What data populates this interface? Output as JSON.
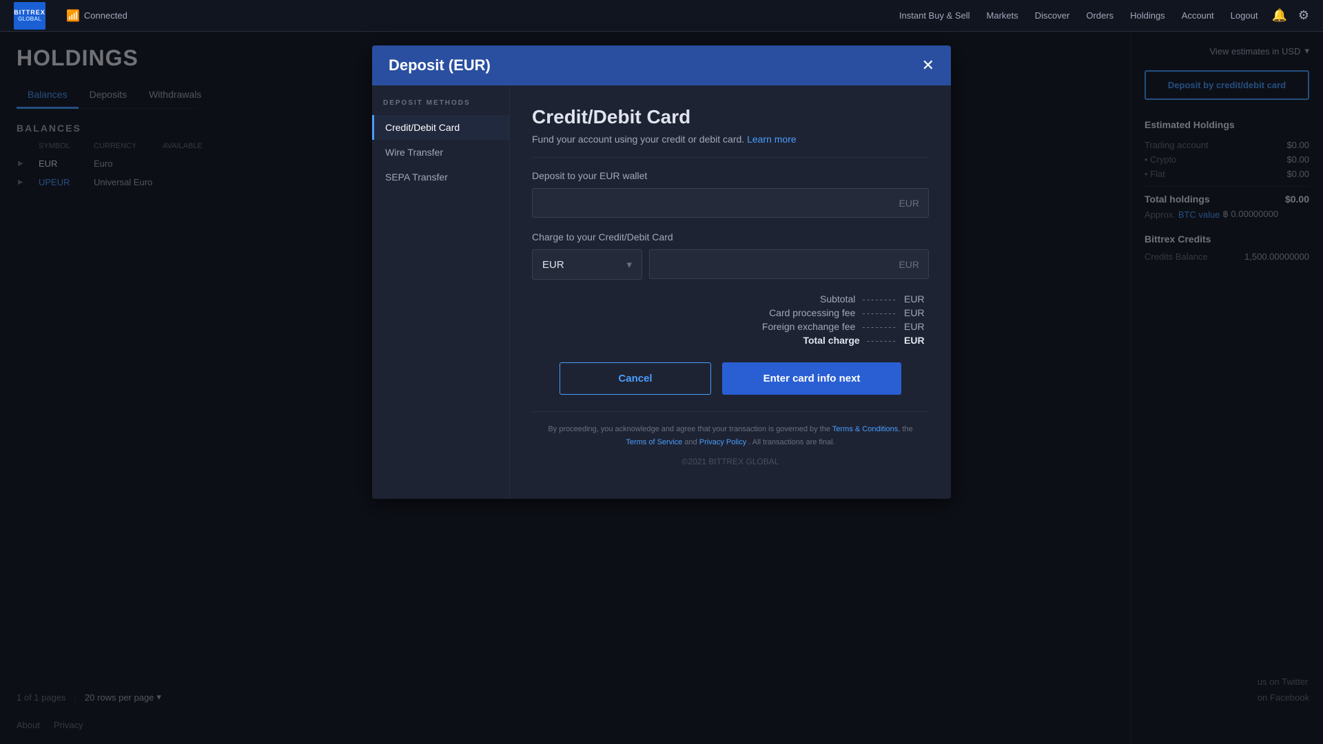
{
  "app": {
    "logo_line1": "BITTREX",
    "logo_line2": "GLOBAL"
  },
  "topnav": {
    "connected_label": "Connected",
    "nav_links": [
      {
        "label": "Instant Buy & Sell",
        "key": "instant-buy-sell"
      },
      {
        "label": "Markets",
        "key": "markets"
      },
      {
        "label": "Discover",
        "key": "discover"
      },
      {
        "label": "Orders",
        "key": "orders"
      },
      {
        "label": "Holdings",
        "key": "holdings"
      },
      {
        "label": "Account",
        "key": "account"
      },
      {
        "label": "Logout",
        "key": "logout"
      }
    ]
  },
  "left": {
    "page_title": "HOLDINGS",
    "tabs": [
      {
        "label": "Balances",
        "active": true
      },
      {
        "label": "Deposits",
        "active": false
      },
      {
        "label": "Withdrawals",
        "active": false
      }
    ],
    "balances_title": "BALANCES",
    "table_headers": [
      "",
      "SYMBOL",
      "CURRENCY",
      "AVAILABLE"
    ],
    "rows": [
      {
        "symbol": "EUR",
        "currency": "Euro",
        "available": ""
      },
      {
        "symbol": "UPEUR",
        "currency": "Universal Euro",
        "available": "",
        "link": true
      }
    ],
    "pagination": {
      "pages_text": "1 of 1 pages",
      "rows_label": "20 rows per page"
    },
    "footer": {
      "about": "About",
      "privacy": "Privacy"
    }
  },
  "modal": {
    "title": "Deposit (EUR)",
    "deposit_methods_label": "DEPOSIT METHODS",
    "methods": [
      {
        "label": "Credit/Debit Card",
        "active": true
      },
      {
        "label": "Wire Transfer",
        "active": false
      },
      {
        "label": "SEPA Transfer",
        "active": false
      }
    ],
    "card_title": "Credit/Debit Card",
    "card_subtitle": "Fund your account using your credit or debit card.",
    "learn_more": "Learn more",
    "deposit_wallet_label": "Deposit to your EUR wallet",
    "deposit_currency": "EUR",
    "charge_label": "Charge to your Credit/Debit Card",
    "charge_currency_option": "EUR",
    "charge_currency_placeholder": "EUR",
    "charge_input_currency": "EUR",
    "fees": {
      "subtotal_label": "Subtotal",
      "subtotal_dashes": "--------",
      "subtotal_currency": "EUR",
      "card_fee_label": "Card processing fee",
      "card_fee_dashes": "--------",
      "card_fee_currency": "EUR",
      "fx_fee_label": "Foreign exchange fee",
      "fx_fee_dashes": "--------",
      "fx_fee_currency": "EUR",
      "total_label": "Total charge",
      "total_dashes": "-------",
      "total_currency": "EUR"
    },
    "cancel_label": "Cancel",
    "enter_card_label": "Enter card info next",
    "footer_text": "By proceeding, you acknowledge and agree that your transaction is governed by the",
    "terms_conditions": "Terms & Conditions",
    "footer_text2": ", the",
    "terms_service": "Terms of Service",
    "footer_and": "and",
    "privacy_policy": "Privacy Policy",
    "footer_text3": ". All transactions are final.",
    "copyright": "©2021 BITTREX GLOBAL"
  },
  "right": {
    "view_estimates": "View estimates in USD",
    "deposit_btn": "Deposit by credit/debit card",
    "estimated_title": "Estimated Holdings",
    "trading_account": "Trading account",
    "trading_value": "$0.00",
    "crypto_label": "• Crypto",
    "crypto_value": "$0.00",
    "flat_label": "• Flat",
    "flat_value": "$0.00",
    "total_holdings_label": "Total holdings",
    "total_holdings_value": "$0.00",
    "approx_label": "Approx.",
    "btc_link": "BTC value",
    "btc_value": "฿ 0.00000000",
    "credits_title": "Bittrex Credits",
    "credits_balance_label": "Credits Balance",
    "credits_balance_value": "1,500.00000000",
    "social_twitter": "us on Twitter",
    "social_facebook": "on Facebook"
  }
}
